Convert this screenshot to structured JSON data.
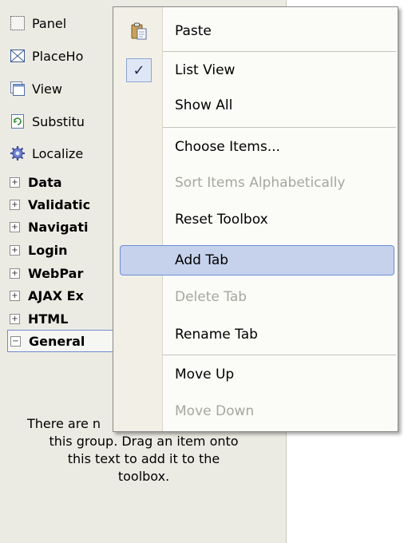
{
  "toolbox": {
    "items": [
      {
        "label": "Panel",
        "icon": "panel-icon"
      },
      {
        "label": "PlaceHo",
        "icon": "placeholder-icon"
      },
      {
        "label": "View",
        "icon": "view-icon"
      },
      {
        "label": "Substitu",
        "icon": "substitution-icon"
      },
      {
        "label": "Localize",
        "icon": "localize-icon"
      }
    ],
    "tabs": [
      {
        "label": "Data"
      },
      {
        "label": "Validatic"
      },
      {
        "label": "Navigati"
      },
      {
        "label": "Login"
      },
      {
        "label": "WebPar"
      },
      {
        "label": "AJAX Ex"
      },
      {
        "label": "HTML"
      },
      {
        "label": "General"
      }
    ],
    "empty_message_line1": "There are n",
    "empty_message_line2": "this group. Drag an item onto",
    "empty_message_line3": "this text to add it to the",
    "empty_message_line4": "toolbox."
  },
  "context_menu": {
    "items": [
      {
        "label": "Paste",
        "enabled": true,
        "icon": "paste-icon"
      },
      {
        "label": "List View",
        "enabled": true,
        "checked": true
      },
      {
        "label": "Show All",
        "enabled": true
      },
      {
        "label": "Choose Items...",
        "enabled": true
      },
      {
        "label": "Sort Items Alphabetically",
        "enabled": false
      },
      {
        "label": "Reset Toolbox",
        "enabled": true
      },
      {
        "label": "Add Tab",
        "enabled": true,
        "highlighted": true
      },
      {
        "label": "Delete Tab",
        "enabled": false
      },
      {
        "label": "Rename Tab",
        "enabled": true
      },
      {
        "label": "Move Up",
        "enabled": true
      },
      {
        "label": "Move Down",
        "enabled": false
      }
    ],
    "checkmark": "✓"
  },
  "colors": {
    "toolbox_bg": "#ecebe3",
    "menu_bg": "#fbfbf8",
    "highlight_bg": "#c6d2ec",
    "highlight_border": "#6b8fd6",
    "disabled_text": "#a7a6a0"
  }
}
